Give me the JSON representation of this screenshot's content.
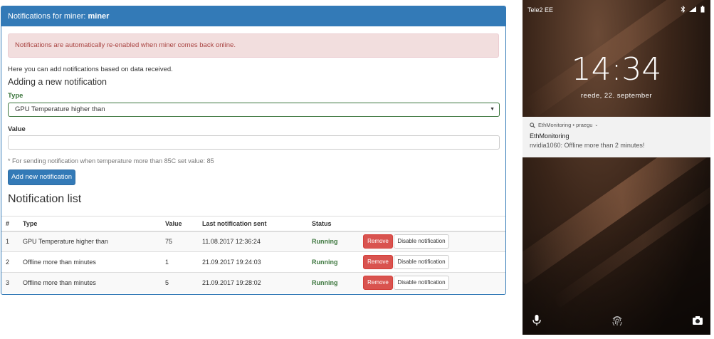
{
  "web": {
    "heading_prefix": "Notifications for miner: ",
    "heading_miner": "miner",
    "alert": "Notifications are automatically re-enabled when miner comes back online.",
    "intro": "Here you can add notifications based on data received.",
    "subheading": "Adding a new notification",
    "type_label": "Type",
    "type_selected": "GPU Temperature higher than",
    "value_label": "Value",
    "value_input": "",
    "help_text": "* For sending notification when temperature more than 85C set value: 85",
    "add_button": "Add new notification",
    "list_title": "Notification list",
    "table": {
      "headers": [
        "#",
        "Type",
        "Value",
        "Last notification sent",
        "Status",
        ""
      ],
      "rows": [
        {
          "num": "1",
          "type": "GPU Temperature higher than",
          "value": "75",
          "last": "11.08.2017 12:36:24",
          "status": "Running"
        },
        {
          "num": "2",
          "type": "Offline more than minutes",
          "value": "1",
          "last": "21.09.2017 19:24:03",
          "status": "Running"
        },
        {
          "num": "3",
          "type": "Offline more than minutes",
          "value": "5",
          "last": "21.09.2017 19:28:02",
          "status": "Running"
        }
      ],
      "remove_label": "Remove",
      "disable_label": "Disable notification"
    },
    "colors": {
      "primary": "#337ab7",
      "danger": "#d9534f",
      "success": "#3c763d"
    }
  },
  "phone": {
    "carrier": "Tele2 EE",
    "time": "14:34",
    "date": "reede, 22. september",
    "notification": {
      "app": "EthMonitoring • praegu",
      "title": "EthMonitoring",
      "body": "nvidia1060: Offline more than 2 minutes!"
    },
    "icons": [
      "bluetooth-icon",
      "signal-icon",
      "battery-icon",
      "microphone-icon",
      "fingerprint-icon",
      "camera-icon"
    ]
  }
}
